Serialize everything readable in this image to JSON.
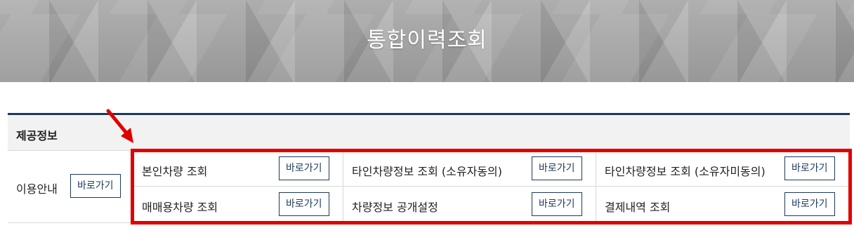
{
  "header": {
    "title": "통합이력조회"
  },
  "table": {
    "header_label": "제공정보",
    "row_label": "이용안내",
    "row_button": "바로가기",
    "items": [
      {
        "label": "본인차량 조회",
        "button": "바로가기"
      },
      {
        "label": "타인차량정보 조회 (소유자동의)",
        "button": "바로가기"
      },
      {
        "label": "타인차량정보 조회 (소유자미동의)",
        "button": "바로가기"
      },
      {
        "label": "매매용차량 조회",
        "button": "바로가기"
      },
      {
        "label": "차량정보 공개설정",
        "button": "바로가기"
      },
      {
        "label": "결제내역 조회",
        "button": "바로가기"
      }
    ]
  },
  "colors": {
    "accent": "#1b3a5c",
    "highlight": "#e00000"
  }
}
